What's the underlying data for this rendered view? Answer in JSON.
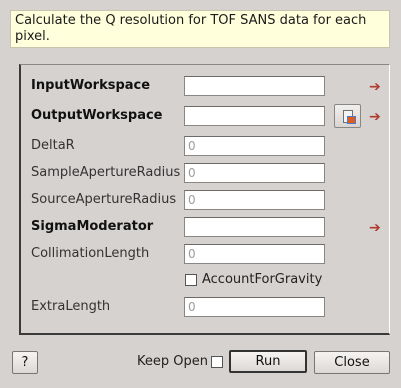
{
  "description": "Calculate the Q resolution for TOF SANS data for each pixel.",
  "properties": [
    {
      "label": "InputWorkspace",
      "value": "",
      "required": true
    },
    {
      "label": "OutputWorkspace",
      "value": "",
      "required": true
    },
    {
      "label": "DeltaR",
      "value": "0",
      "required": false
    },
    {
      "label": "SampleApertureRadius",
      "value": "0",
      "required": false
    },
    {
      "label": "SourceApertureRadius",
      "value": "0",
      "required": false
    },
    {
      "label": "SigmaModerator",
      "value": "",
      "required": true
    },
    {
      "label": "CollimationLength",
      "value": "0",
      "required": false
    },
    {
      "label": "AccountForGravity",
      "checked": false
    },
    {
      "label": "ExtraLength",
      "value": "0",
      "required": false
    }
  ],
  "required_marker": "➔",
  "browse_icon": "browse-workspace-icon",
  "footer": {
    "help_label": "?",
    "keep_open_label": "Keep Open",
    "keep_open_checked": false,
    "run_label": "Run",
    "close_label": "Close"
  }
}
